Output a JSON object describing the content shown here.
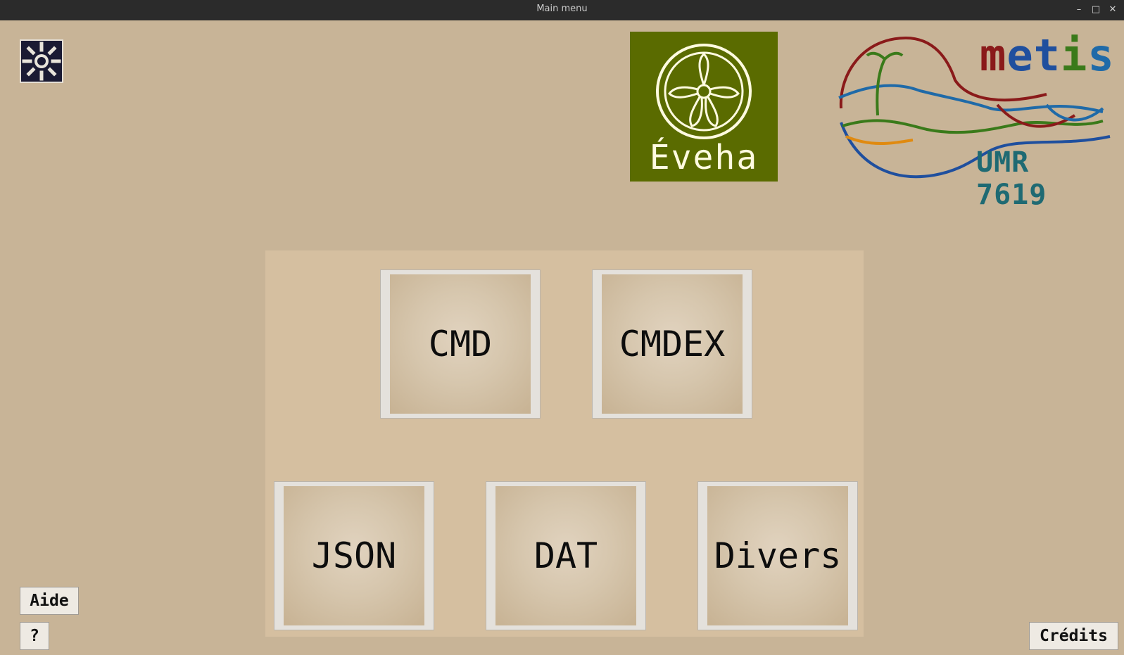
{
  "window": {
    "title": "Main menu",
    "controls": {
      "minimize": "–",
      "maximize": "□",
      "close": "✕"
    }
  },
  "logos": {
    "eveha": "Éveha",
    "metis": {
      "letters": [
        "m",
        "e",
        "t",
        "i",
        "s"
      ],
      "colors": [
        "#8a1a1a",
        "#8a1a1a",
        "#1f4f9e",
        "#3a7a1a",
        "#e08a10",
        "#1f4f9e"
      ],
      "subtitle": "UMR 7619"
    }
  },
  "menu": {
    "top_row": [
      {
        "label": "CMD"
      },
      {
        "label": "CMDEX"
      }
    ],
    "bottom_row": [
      {
        "label": "JSON"
      },
      {
        "label": "DAT"
      },
      {
        "label": "Divers"
      }
    ]
  },
  "buttons": {
    "settings_icon": "sun-gear-icon",
    "aide": "Aide",
    "help": "?",
    "credits": "Crédits"
  },
  "colors": {
    "background": "#c8b497",
    "panel": "#d5bfa0",
    "eveha_green": "#5a6b00",
    "titlebar": "#2b2b2b"
  }
}
